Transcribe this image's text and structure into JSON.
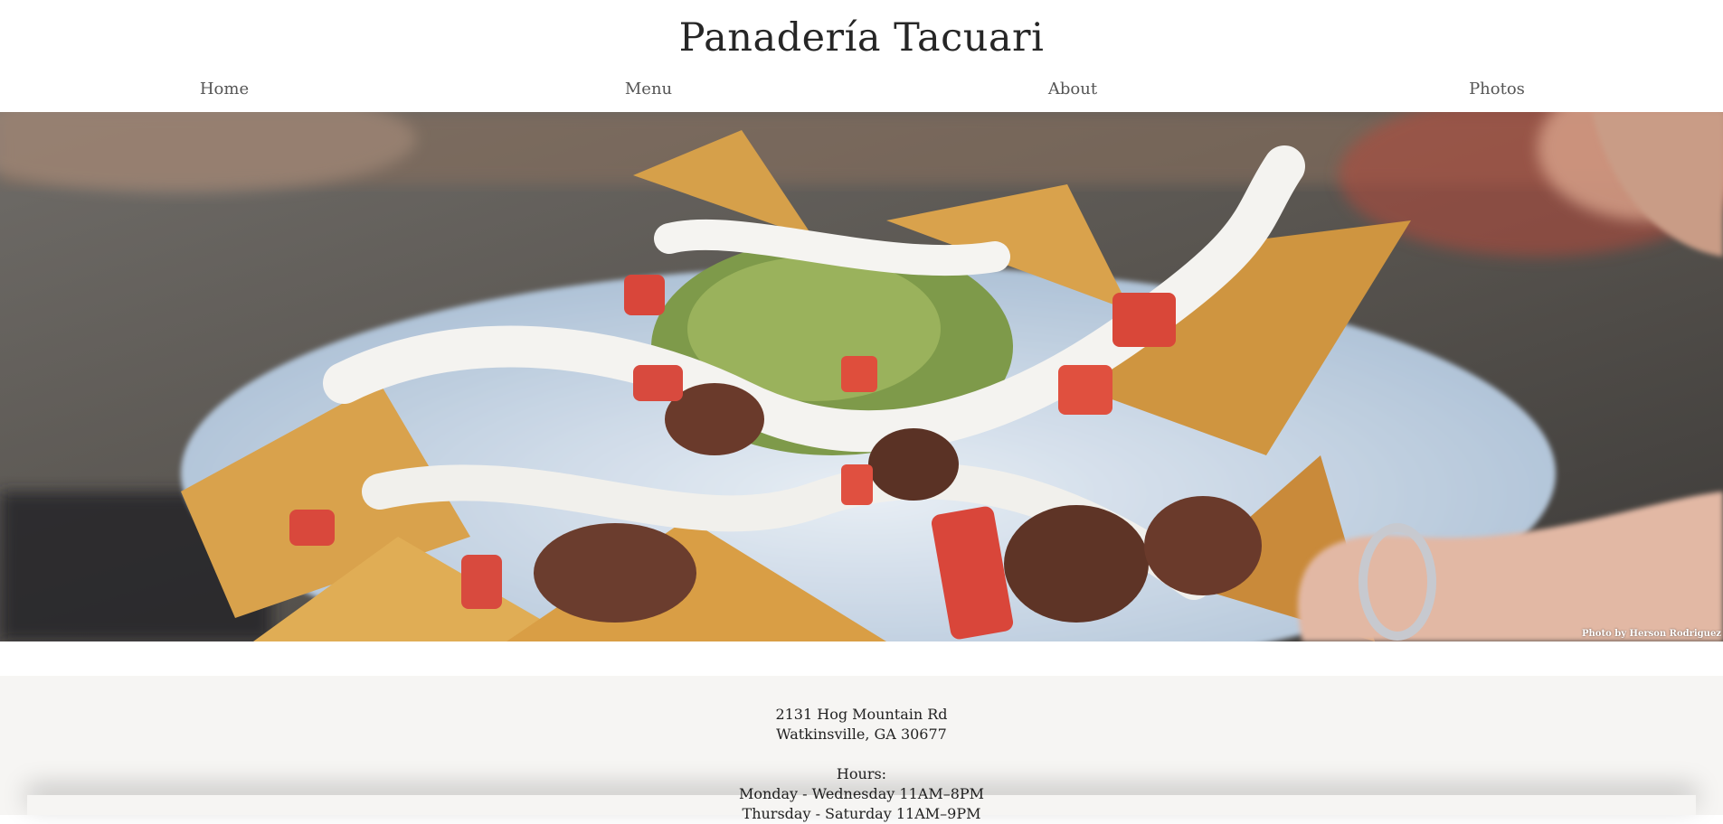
{
  "site": {
    "title": "Panadería Tacuari"
  },
  "nav": {
    "items": [
      "Home",
      "Menu",
      "About",
      "Photos"
    ]
  },
  "hero": {
    "credit": "Photo by Herson Rodriguez"
  },
  "info": {
    "address_line1": "2131 Hog Mountain Rd",
    "address_line2": "Watkinsville, GA 30677",
    "hours_label": "Hours:",
    "hours_line1": "Monday - Wednesday 11AM–8PM",
    "hours_line2": "Thursday - Saturday 11AM–9PM"
  }
}
